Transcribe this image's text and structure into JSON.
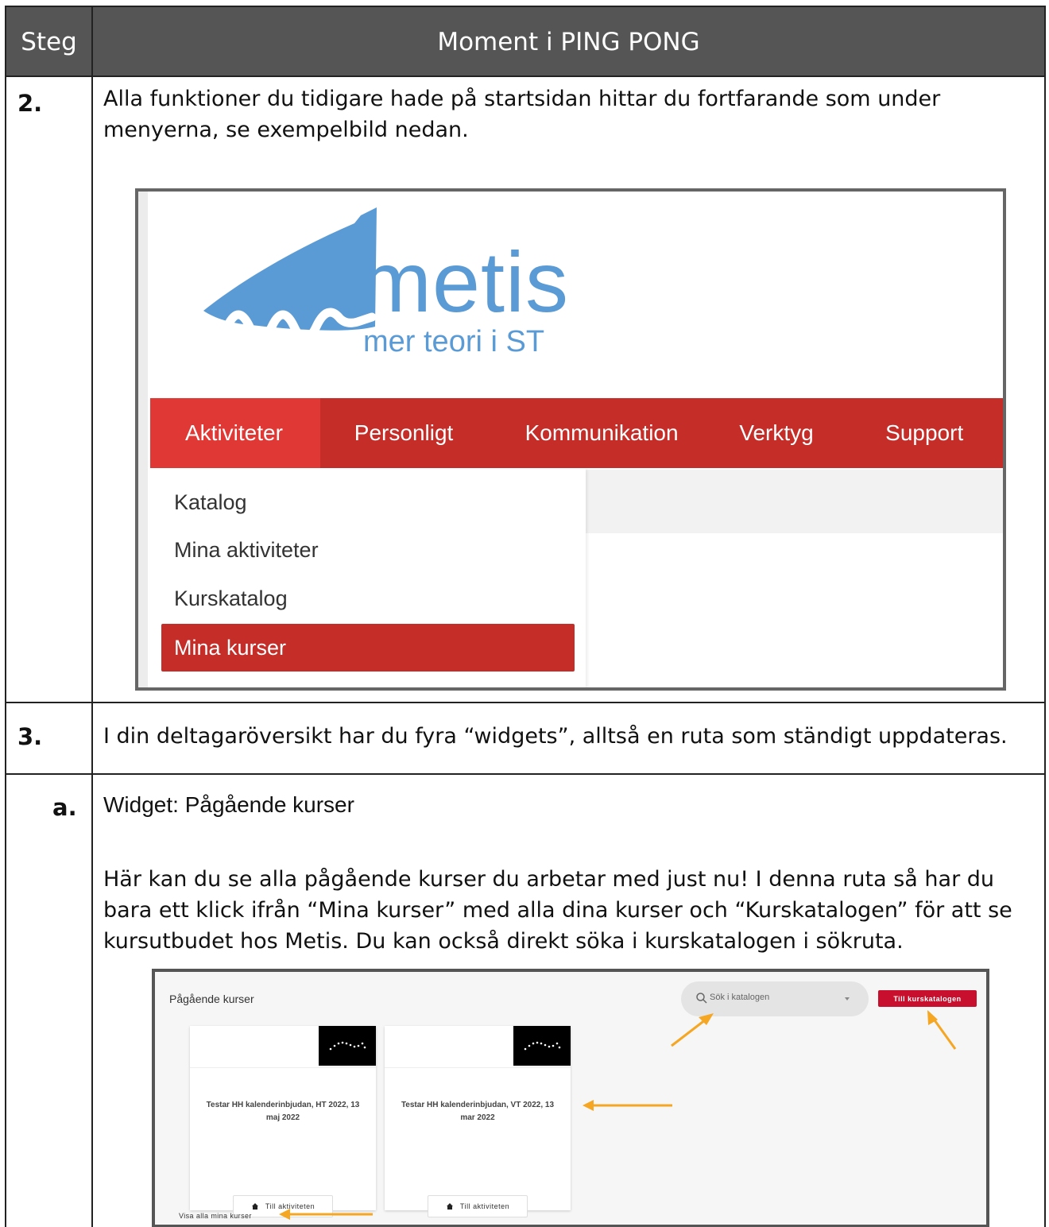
{
  "header": {
    "step": "Steg",
    "moment": "Moment i PING PONG"
  },
  "rows": [
    {
      "step": "2.",
      "text": "Alla funktioner du tidigare hade på startsidan hittar du fortfarande som under menyerna, se exempelbild nedan."
    },
    {
      "step": "3.",
      "text": "I din deltagaröversikt har du fyra “widgets”, alltså en ruta som ständigt uppdateras."
    },
    {
      "step": "a.",
      "heading": "Widget: Pågående kurser",
      "text": "Här kan du se alla pågående kurser du arbetar med just nu! I denna ruta så har du bara ett klick ifrån “Mina kurser” med alla dina kurser och “Kurskatalogen” för att se kursutbudet hos Metis. Du kan också direkt söka i kurskatalogen i sökruta."
    }
  ],
  "shot1": {
    "logo": {
      "word": "metis",
      "subtitle": "mer teori i ST",
      "color": "#5b9bd5"
    },
    "nav": [
      "Aktiviteter",
      "Personligt",
      "Kommunikation",
      "Verktyg",
      "Support"
    ],
    "dropdown": [
      "Katalog",
      "Mina aktiviteter",
      "Kurskatalog",
      "Mina kurser"
    ],
    "accent": "#c52d29"
  },
  "shot2": {
    "title": "Pågående kurser",
    "search_placeholder": "Sök i katalogen",
    "catalog_button": "Till kurskatalogen",
    "cards": [
      {
        "title": "Testar HH kalenderinbjudan, HT 2022, 13 maj 2022",
        "button": "Till aktiviteten"
      },
      {
        "title": "Testar HH kalenderinbjudan, VT 2022, 13 mar 2022",
        "button": "Till aktiviteten"
      }
    ],
    "show_all": "Visa alla mina kurser",
    "arrow_color": "#f5a623"
  }
}
